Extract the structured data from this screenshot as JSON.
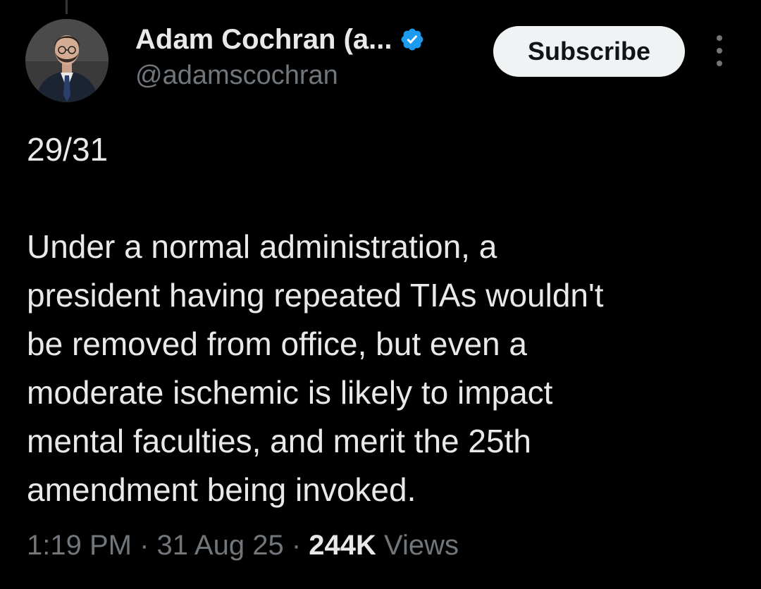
{
  "author": {
    "display_name": "Adam Cochran (a...",
    "handle": "@adamscochran",
    "verified_color": "#1d9bf0"
  },
  "actions": {
    "subscribe_label": "Subscribe",
    "more_icon": "more-vertical-icon"
  },
  "tweet": {
    "thread_position": "29/31",
    "body_lines": [
      "Under a normal administration, a",
      "president having repeated TIAs wouldn't",
      "be removed from office, but even a",
      "moderate ischemic is likely to impact",
      "mental faculties, and merit the 25th",
      "amendment being invoked."
    ]
  },
  "meta": {
    "time": "1:19 PM",
    "separator": " · ",
    "date": "31 Aug 25",
    "views_count": "244K",
    "views_label": " Views"
  },
  "colors": {
    "background": "#000000",
    "text_primary": "#e7e9ea",
    "text_secondary": "#71767b",
    "button_bg": "#eff3f4"
  }
}
